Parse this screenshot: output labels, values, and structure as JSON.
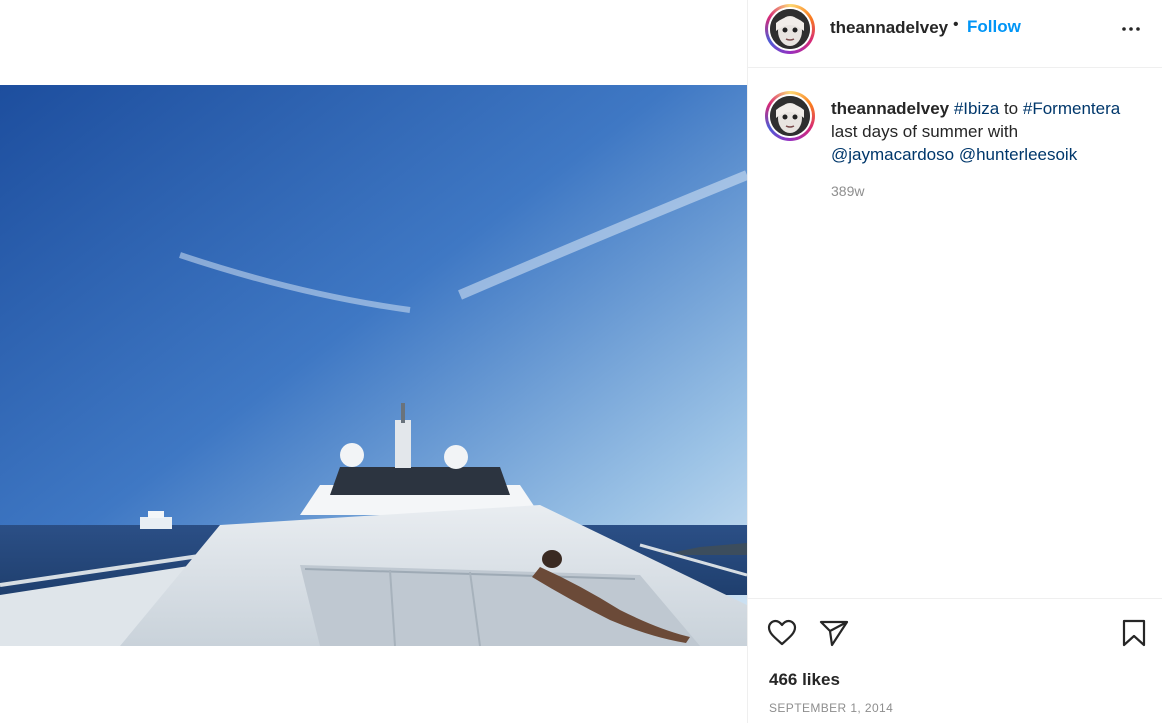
{
  "post": {
    "username": "theannadelvey",
    "separator": "•",
    "follow_label": "Follow",
    "more_icon": "more-options-icon",
    "image_alt_subject": "yacht-photo"
  },
  "caption": {
    "username": "theannadelvey",
    "hashtag_1": "#Ibiza",
    "word_to": "to",
    "hashtag_2": "#Formentera",
    "text": "last days of summer with",
    "mention_1": "@jaymacardoso",
    "mention_2": "@hunterleesoik",
    "time_ago": "389w"
  },
  "actions": {
    "like_icon": "heart-icon",
    "share_icon": "send-icon",
    "save_icon": "bookmark-icon",
    "likes_text": "466 likes",
    "date_text": "SEPTEMBER 1, 2014"
  },
  "colors": {
    "accent": "#0095f6",
    "link": "#00376b",
    "muted": "#8e8e8e",
    "text": "#262626"
  }
}
